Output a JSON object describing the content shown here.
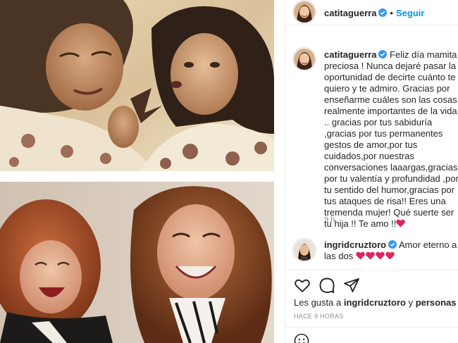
{
  "post": {
    "author": {
      "username": "catitaguerra",
      "verified": true
    },
    "follow_label": "Seguir",
    "follow_separator": "•",
    "caption": "Feliz día mamita preciosa ! Nunca dejaré pasar la oportunidad de decirte cuánto te quiero y te admiro. Gracias por enseñarme cuáles son las cosas realmente importantes de la vida .. gracias por tus sabiduría ,gracias por tus permanentes gestos de amor,por tus cuidados,por nuestras conversaciones laaargas,gracias por tu valentía y profundidad ,por tu sentido del humor,gracias por tus ataques de risa!! Eres una tremenda mujer! Qué suerte ser tu hija !! Te amo !!",
    "caption_hearts": 1,
    "time_ago": "9 h",
    "date_label": "HACE 9 HORAS",
    "likes": {
      "prefix": "Les gusta a",
      "user": "ingridcruztoro",
      "conjunction": "y",
      "others": "personas más"
    }
  },
  "comment": {
    "username": "ingridcruztoro",
    "verified": true,
    "text": "Amor eterno a las dos",
    "hearts": 4
  },
  "icons": {
    "like": "heart-outline-icon",
    "comment": "comment-bubble-icon",
    "share": "paper-plane-icon",
    "verified": "verified-badge-icon",
    "emoji": "smiley-icon"
  },
  "colors": {
    "link_blue": "#0095f6",
    "verified_blue": "#3897f0",
    "heart_red": "#e0245e",
    "secondary_text": "#8e8e8e"
  }
}
